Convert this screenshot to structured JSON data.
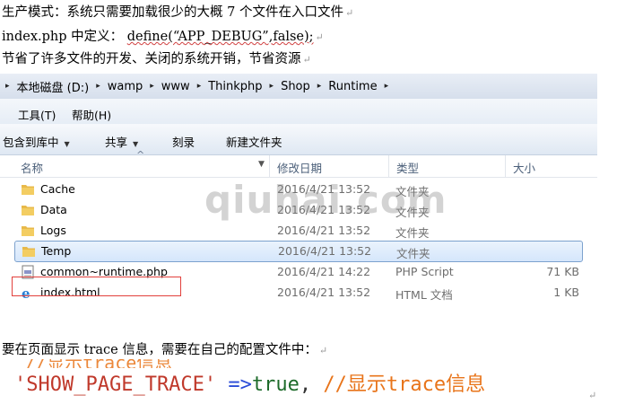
{
  "doc": {
    "line1": "生产模式：系统只需要加载很少的大概 7 个文件在入口文件",
    "line2_prefix": "index.php 中定义：",
    "line2_code": "define(“APP_DEBUG”,false);",
    "line3": "节省了许多文件的开发、关闭的系统开销，节省资源",
    "line4": "要在页面显示 trace 信息，需要在自己的配置文件中：",
    "pilcrow": "↵"
  },
  "address_bar": {
    "crumbs": [
      "本地磁盘 (D:)",
      "wamp",
      "www",
      "Thinkphp",
      "Shop",
      "Runtime"
    ],
    "separator": "▸"
  },
  "menu": {
    "tools": "工具(T)",
    "help": "帮助(H)"
  },
  "toolbar": {
    "include_in_library": "包含到库中",
    "share": "共享",
    "burn": "刻录",
    "new_folder": "新建文件夹",
    "caret": "▼"
  },
  "columns": {
    "name": "名称",
    "date_modified": "修改日期",
    "type": "类型",
    "size": "大小",
    "sort_indicator": "^"
  },
  "files": [
    {
      "name": "Cache",
      "date": "2016/4/21 13:52",
      "type": "文件夹",
      "size": "",
      "icon": "folder-icon"
    },
    {
      "name": "Data",
      "date": "2016/4/21 13:52",
      "type": "文件夹",
      "size": "",
      "icon": "folder-icon"
    },
    {
      "name": "Logs",
      "date": "2016/4/21 13:52",
      "type": "文件夹",
      "size": "",
      "icon": "folder-icon"
    },
    {
      "name": "Temp",
      "date": "2016/4/21 13:52",
      "type": "文件夹",
      "size": "",
      "icon": "folder-icon"
    },
    {
      "name": "common~runtime.php",
      "date": "2016/4/21 14:22",
      "type": "PHP Script",
      "size": "71 KB",
      "icon": "php-file-icon"
    },
    {
      "name": "index.html",
      "date": "2016/4/21 13:52",
      "type": "HTML 文档",
      "size": "1 KB",
      "icon": "ie-html-icon"
    }
  ],
  "watermark": "qiuhai.com",
  "code": {
    "key": "'SHOW_PAGE_TRACE'",
    "arrow": "=>",
    "value": "true",
    "comma": ",",
    "comment": "//显示trace信息"
  },
  "colors": {
    "highlight_border": "#e2403c",
    "selected_row": "#d5e6fb",
    "code_string": "#c0392b",
    "code_comment": "#e8741a"
  }
}
